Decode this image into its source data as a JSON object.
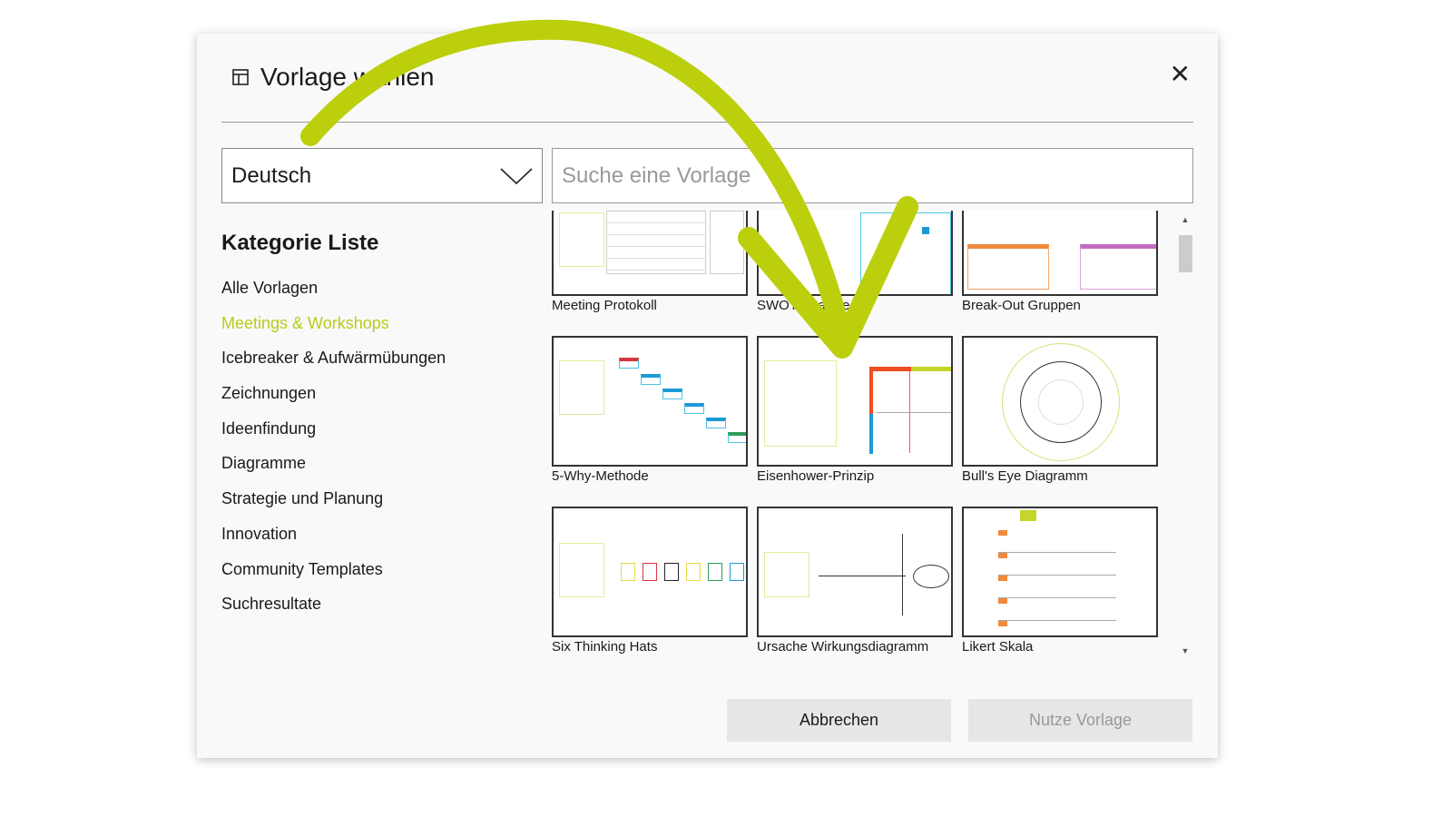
{
  "dialog": {
    "title": "Vorlage wählen",
    "close_icon": "close-icon",
    "title_icon": "template-icon"
  },
  "language": {
    "selected": "Deutsch"
  },
  "search": {
    "placeholder": "Suche eine Vorlage"
  },
  "categories": {
    "title": "Kategorie Liste",
    "items": [
      "Alle Vorlagen",
      "Meetings & Workshops",
      "Icebreaker & Aufwärmübungen",
      "Zeichnungen",
      "Ideenfindung",
      "Diagramme",
      "Strategie und Planung",
      "Innovation",
      "Community Templates",
      "Suchresultate"
    ],
    "active": "Meetings & Workshops"
  },
  "templates": [
    "Meeting Protokoll",
    "SWOT-Analyse",
    "Break-Out Gruppen",
    "5-Why-Methode",
    "Eisenhower-Prinzip",
    "Bull's Eye Diagramm",
    "Six Thinking Hats",
    "Ursache Wirkungsdiagramm",
    "Likert Skala"
  ],
  "buttons": {
    "cancel": "Abbrechen",
    "use": "Nutze Vorlage"
  },
  "colors": {
    "accent": "#b8cc1a",
    "arrow": "#bccf0c"
  }
}
